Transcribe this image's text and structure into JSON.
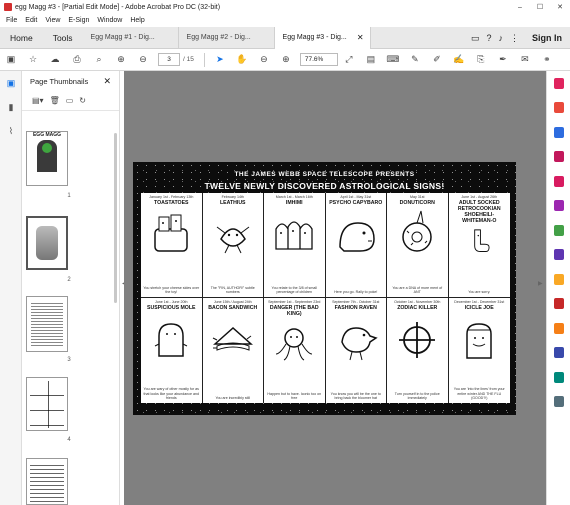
{
  "window": {
    "title": "egg Magg #3 - [Partial Edit Mode] - Adobe Acrobat Pro DC (32-bit)",
    "controls": [
      "–",
      "☐",
      "✕"
    ]
  },
  "menu": [
    "File",
    "Edit",
    "View",
    "E-Sign",
    "Window",
    "Help"
  ],
  "nav": {
    "home": "Home",
    "tools": "Tools"
  },
  "tabs": [
    {
      "label": "Egg Magg #1 - Dig..."
    },
    {
      "label": "Egg Magg #2 - Dig..."
    },
    {
      "label": "Egg Magg #3 - Dig...",
      "active": true
    }
  ],
  "sign_in": "Sign In",
  "toolbar": {
    "page_current": "3",
    "page_total": "/ 15",
    "zoom": "77.6%"
  },
  "thumbnails": {
    "title": "Page Thumbnails",
    "pages": [
      {
        "num": "1",
        "caption": "EGG MAGG"
      },
      {
        "num": "2"
      },
      {
        "num": "3"
      },
      {
        "num": "4"
      },
      {
        "num": "5"
      }
    ]
  },
  "document": {
    "subtitle": "THE JAMES WEBB SPACE TELESCOPE PRESENTS",
    "title": "TWELVE NEWLY DISCOVERED ASTROLOGICAL SIGNS!",
    "signs": [
      {
        "dates": "January 1st - February 13th",
        "name": "TOASTATOES",
        "desc": "You stretch your cheese sides over the toy!"
      },
      {
        "dates": "February 14th",
        "name": "LEATHIUS",
        "desc": "The \"FIN, AUTHOR!\" subtle numbers"
      },
      {
        "dates": "March 1st - March 16th",
        "name": "IMHIMI",
        "desc": "You relate to the 3/8 of small percentage of children"
      },
      {
        "dates": "April 1st - May 31st",
        "name": "PSYCHO CAPYBARO",
        "desc": "Here you go. Rally to poke!"
      },
      {
        "dates": "May 31st",
        "name": "DONUTICORN",
        "desc": "You are a DNA of more ment of ANT"
      },
      {
        "dates": "June 1st - August 26th",
        "name": "ADULT SOCKED RETROCOOKIAN SHOEHEILI-WHITEMAN-O",
        "desc": "You are sorry."
      },
      {
        "dates": "June 1st - June 20th",
        "name": "SUSPICIOUS MOLE",
        "desc": "You are wary of other mostly for as that looks like your abundance and friends"
      },
      {
        "dates": "June 15th / August 24th",
        "name": "BACON SANDWICH",
        "desc": "You are incredibly still"
      },
      {
        "dates": "September 1st - September 23rd",
        "name": "DANGER (THE BAD KING)",
        "desc": "Happen but to have. Iconic too on free"
      },
      {
        "dates": "September 7th - October 31st",
        "name": "FASHION RAVEN",
        "desc": "You know you will be the one to bring back the bloomer hat"
      },
      {
        "dates": "October 1st - November 30th",
        "name": "ZODIAC KILLER",
        "desc": "Turn yourself in to the police immediately"
      },
      {
        "dates": "December 1st - December 31st",
        "name": "ICICLE JOE",
        "desc": "You are 'into the lines' from your entire winter AND THE FLU (GOOD?!)"
      }
    ]
  }
}
